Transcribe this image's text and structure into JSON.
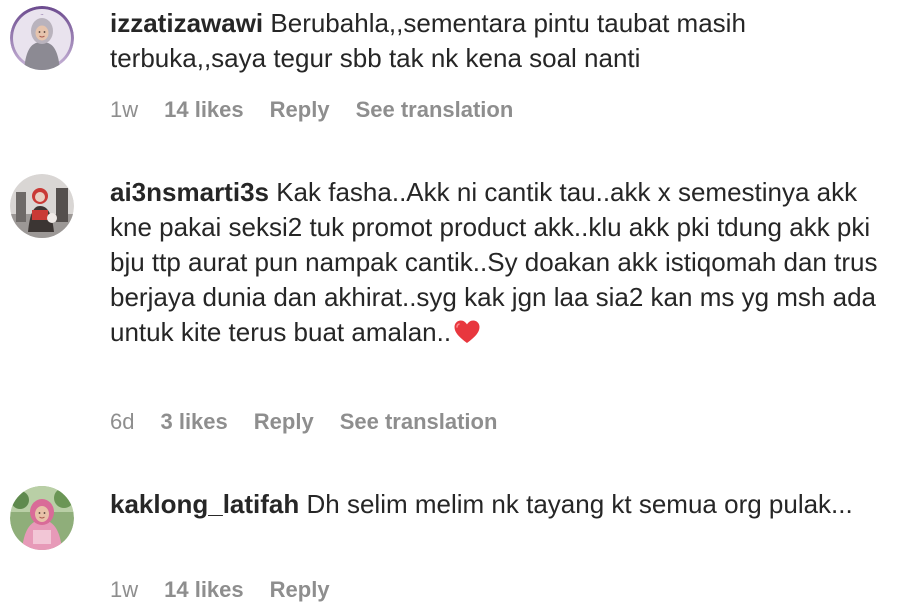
{
  "comments": [
    {
      "username": "izzatizawawi",
      "text": "Berubahla,,sementara pintu taubat masih terbuka,,saya tegur sbb tak nk kena soal nanti",
      "time": "1w",
      "likes": "14 likes",
      "reply": "Reply",
      "translate": "See translation",
      "avatar_icon": "profile-photo-hijab-purple"
    },
    {
      "username": "ai3nsmarti3s",
      "text": "Kak fasha..Akk ni cantik tau..akk x semestinya akk kne pakai seksi2 tuk promot product akk..klu akk pki tdung akk pki bju ttp aurat pun nampak cantik..Sy doakan akk istiqomah dan trus berjaya dunia dan akhirat..syg kak jgn laa sia2 kan ms yg msh ada untuk kite terus buat amalan..",
      "emoji": "red-heart-icon",
      "time": "6d",
      "likes": "3 likes",
      "reply": "Reply",
      "translate": "See translation",
      "avatar_icon": "profile-photo-red-grey"
    },
    {
      "username": "kaklong_latifah",
      "text": "Dh selim melim nk tayang kt semua org pulak...",
      "time": "1w",
      "likes": "14 likes",
      "reply": "Reply",
      "avatar_icon": "profile-photo-pink-hijab-outdoor"
    }
  ],
  "colors": {
    "text": "#262626",
    "meta": "#8e8e8e",
    "heart": "#e8373e"
  }
}
